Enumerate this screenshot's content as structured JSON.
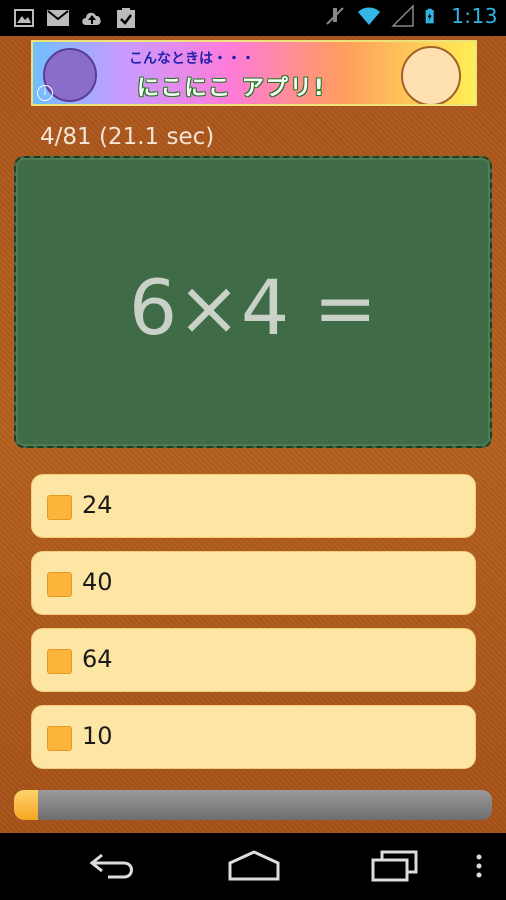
{
  "status_bar": {
    "time": "1:13",
    "left_icons": [
      "image-icon",
      "mail-icon",
      "upload-icon",
      "clipboard-check-icon"
    ],
    "right_icons": [
      "mute-icon",
      "wifi-icon",
      "signal-icon",
      "battery-icon"
    ],
    "icon_color": "#33b5e5"
  },
  "ad": {
    "top_text": "こんなときは・・・",
    "main_text": "にこにこ アプリ!",
    "info_icon": "info-icon"
  },
  "quiz": {
    "progress": "4/81 (21.1 sec)",
    "question": "6×4 =",
    "answers": [
      {
        "label": "24"
      },
      {
        "label": "40"
      },
      {
        "label": "64"
      },
      {
        "label": "10"
      }
    ],
    "time_remaining_fraction": 0.05
  },
  "nav_bar": {
    "buttons": [
      "back-icon",
      "home-icon",
      "recent-apps-icon",
      "overflow-menu-icon"
    ]
  }
}
